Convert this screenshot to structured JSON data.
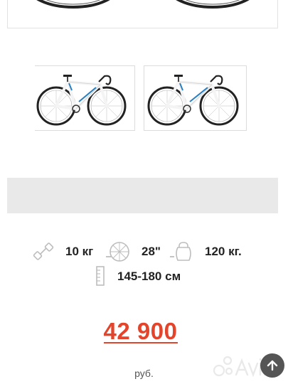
{
  "gallery": {
    "main_image": "bicycle-photo",
    "thumbnails": [
      {
        "image": "bicycle-photo-white-blue"
      },
      {
        "image": "bicycle-photo-white-blue"
      }
    ]
  },
  "specs": {
    "weight": "10 кг",
    "wheel_size": "28\"",
    "max_load": "120 кг.",
    "rider_height": "145-180 см"
  },
  "price": {
    "amount": "42 900",
    "currency": "руб."
  },
  "colors": {
    "accent": "#e2452b",
    "frame_blue": "#2a7fc0",
    "bar_grey": "#e9e9e9"
  }
}
